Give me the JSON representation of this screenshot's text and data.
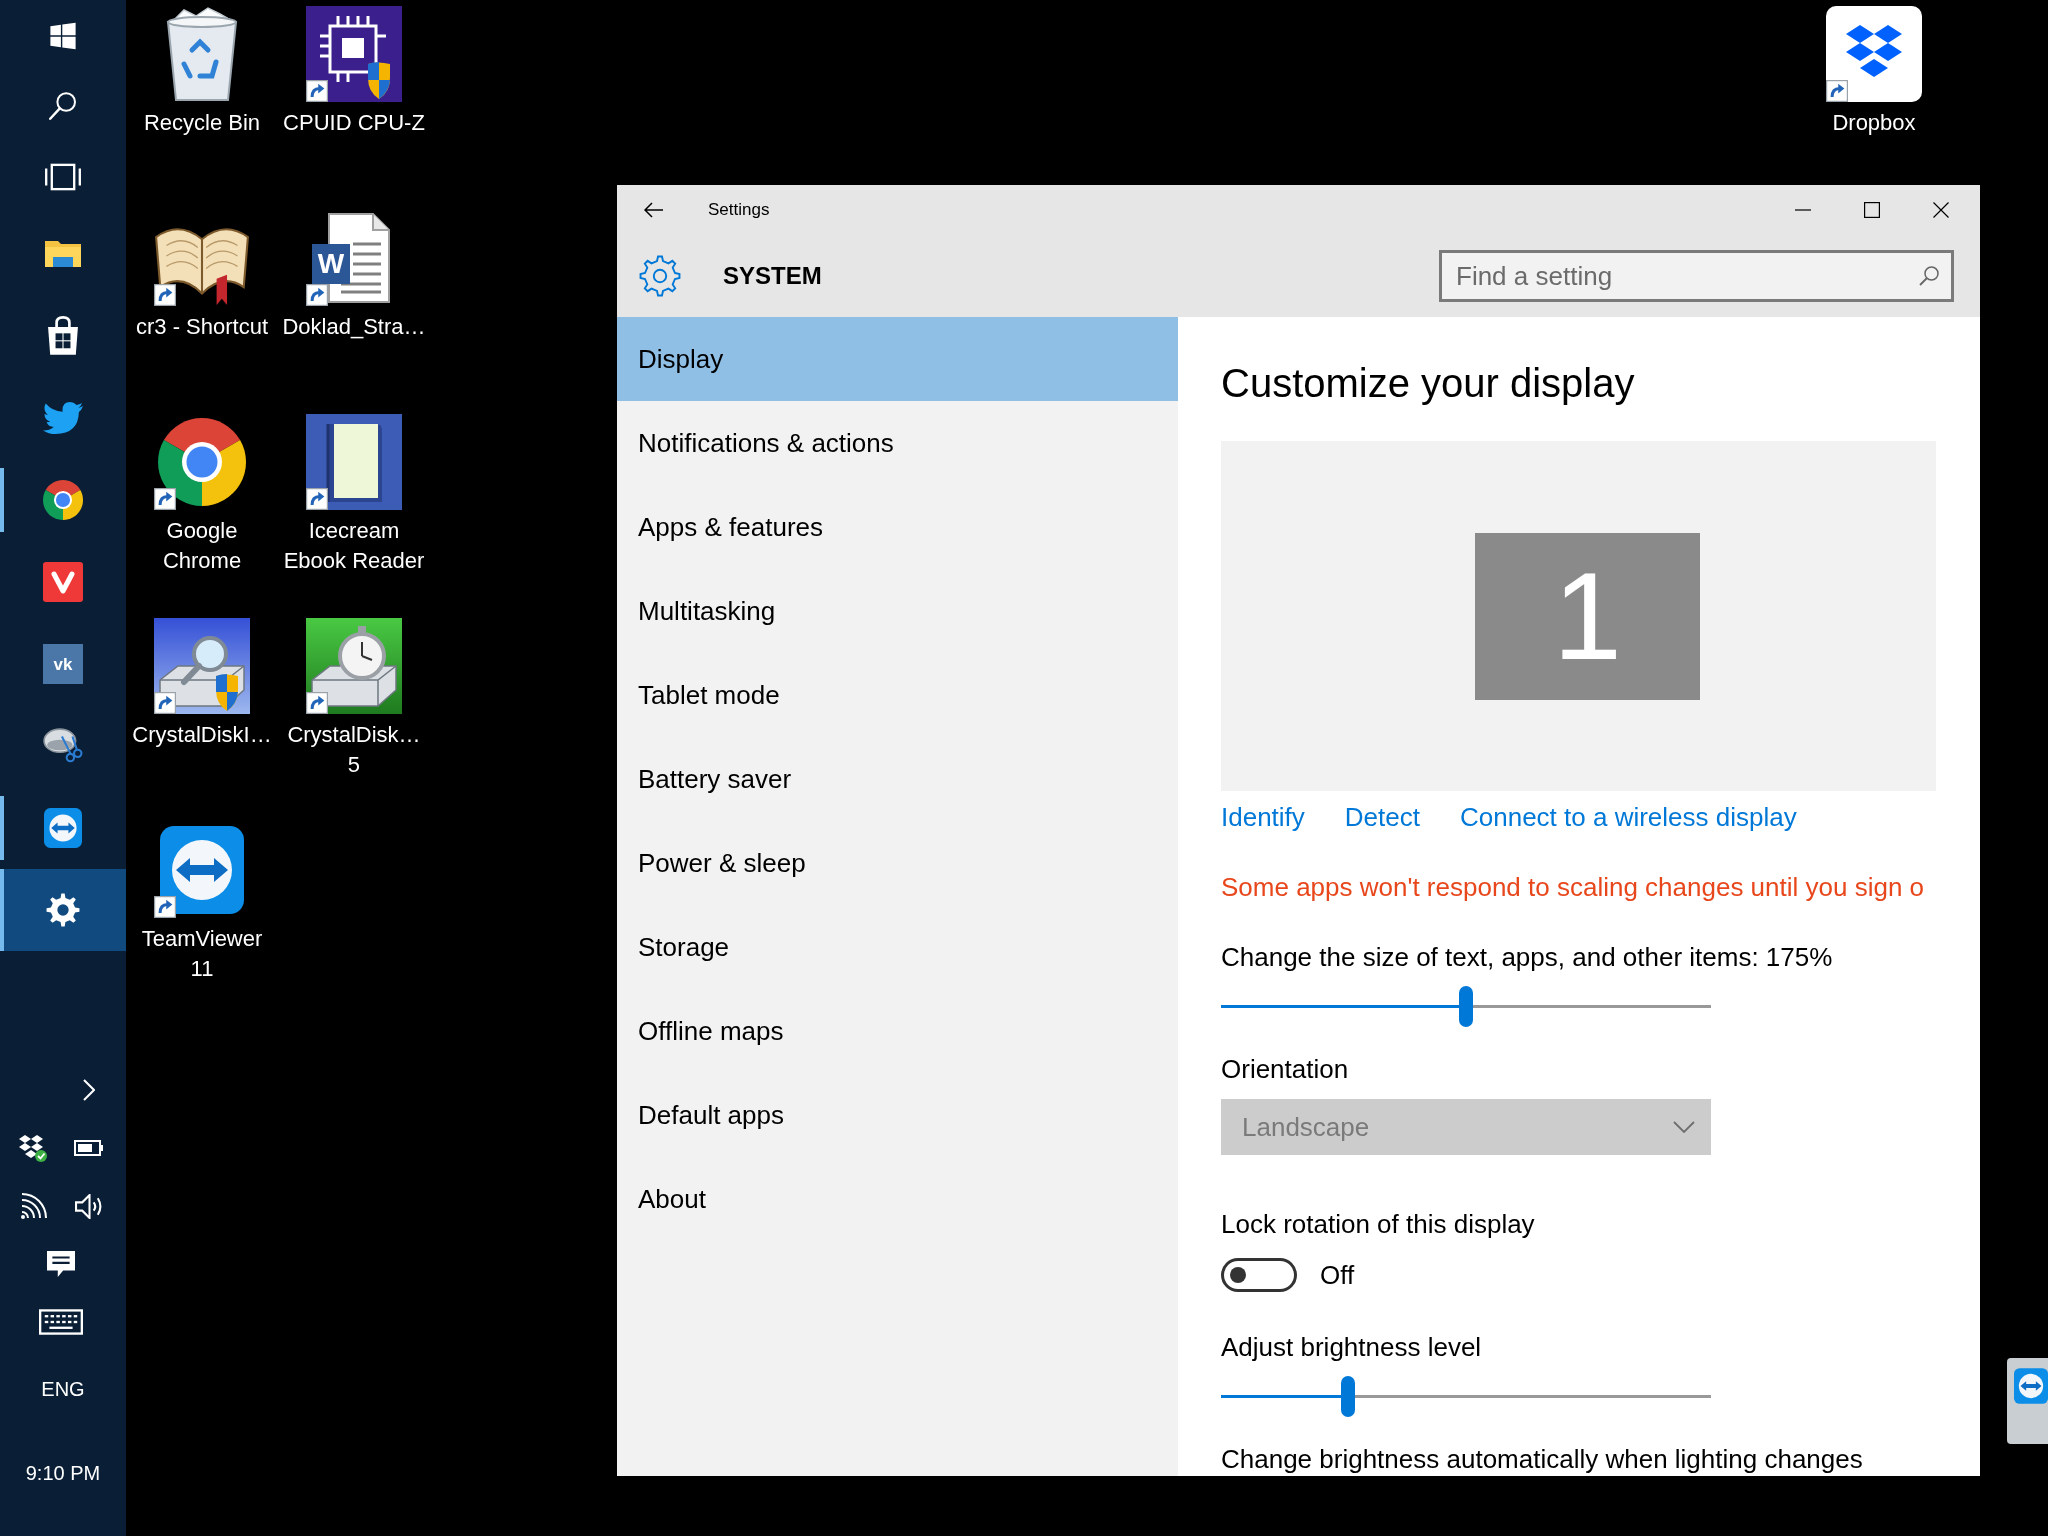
{
  "taskbar": {
    "system_buttons": [
      {
        "kind": "start"
      },
      {
        "kind": "search"
      },
      {
        "kind": "taskview"
      }
    ],
    "apps": [
      {
        "kind": "folder",
        "running": false,
        "selected": false
      },
      {
        "kind": "store",
        "running": false,
        "selected": false
      },
      {
        "kind": "bird",
        "running": false,
        "selected": false
      },
      {
        "kind": "browser",
        "running": true,
        "selected": false
      },
      {
        "kind": "redtile",
        "running": false,
        "selected": false
      },
      {
        "kind": "lettertile",
        "text": "vk",
        "running": false,
        "selected": false
      },
      {
        "kind": "scissors",
        "running": false,
        "selected": false
      },
      {
        "kind": "remote",
        "running": true,
        "selected": false
      },
      {
        "kind": "gear",
        "running": true,
        "selected": true
      }
    ],
    "tray": {
      "icons": [
        {
          "kind": "chevron"
        },
        {
          "kind": "boxes"
        },
        {
          "kind": "battery"
        },
        {
          "kind": "wifi"
        },
        {
          "kind": "volume"
        },
        {
          "kind": "message"
        },
        {
          "kind": "keyboard"
        }
      ],
      "language": "ENG",
      "clock": "9:10 PM"
    }
  },
  "desktop": {
    "icon_rows": [
      [
        {
          "kind": "recycle",
          "label": "Recycle Bin",
          "shortcut": false
        },
        {
          "kind": "chip",
          "label": "CPUID CPU-Z",
          "shortcut": true
        }
      ],
      [
        {
          "kind": "book",
          "label": "cr3 - Shortcut",
          "shortcut": true
        },
        {
          "kind": "document",
          "badge": "W",
          "label": "Doklad_Stra…",
          "shortcut": true
        }
      ],
      [
        {
          "kind": "browser",
          "label": "Google\nChrome",
          "shortcut": true
        },
        {
          "kind": "reader",
          "label": "Icecream\nEbook Reader",
          "shortcut": true
        }
      ],
      [
        {
          "kind": "diskinfo",
          "label": "CrystalDiskI…",
          "shortcut": true
        },
        {
          "kind": "diskmark",
          "label": "CrystalDisk…\n5",
          "shortcut": true
        }
      ],
      [
        {
          "kind": "remote",
          "label": "TeamViewer\n11",
          "shortcut": true
        }
      ]
    ],
    "right_icons": [
      {
        "kind": "boxes",
        "label": "Dropbox",
        "shortcut": true
      }
    ]
  },
  "settings_window": {
    "title": "Settings",
    "section": "SYSTEM",
    "search": {
      "placeholder": "Find a setting"
    },
    "nav": [
      {
        "label": "Display",
        "selected": true
      },
      {
        "label": "Notifications & actions",
        "selected": false
      },
      {
        "label": "Apps & features",
        "selected": false
      },
      {
        "label": "Multitasking",
        "selected": false
      },
      {
        "label": "Tablet mode",
        "selected": false
      },
      {
        "label": "Battery saver",
        "selected": false
      },
      {
        "label": "Power & sleep",
        "selected": false
      },
      {
        "label": "Storage",
        "selected": false
      },
      {
        "label": "Offline maps",
        "selected": false
      },
      {
        "label": "Default apps",
        "selected": false
      },
      {
        "label": "About",
        "selected": false
      }
    ],
    "content": {
      "heading": "Customize your display",
      "monitor": "1",
      "links": [
        "Identify",
        "Detect",
        "Connect to a wireless display"
      ],
      "warning": "Some apps won't respond to scaling changes until you sign o",
      "settings": [
        {
          "kind": "slider",
          "label": "Change the size of text, apps, and other items: 175%",
          "level": 0.5
        },
        {
          "kind": "dropdown",
          "label": "Orientation",
          "value": "Landscape",
          "disabled": true
        },
        {
          "kind": "toggle",
          "label": "Lock rotation of this display",
          "on": false,
          "state_text": "Off"
        },
        {
          "kind": "slider",
          "label": "Adjust brightness level",
          "level": 0.26
        },
        {
          "kind": "label",
          "label": "Change brightness automatically when lighting changes"
        }
      ]
    }
  }
}
